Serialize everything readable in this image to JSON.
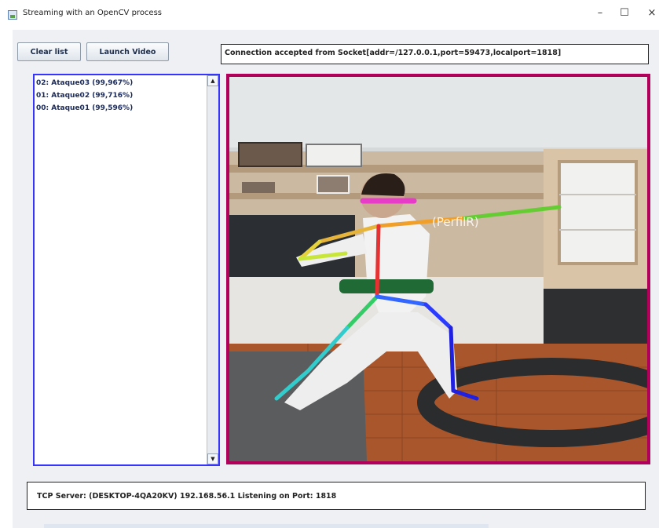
{
  "window": {
    "title": "Streaming with an OpenCV process",
    "controls": [
      "–",
      "☐",
      "×"
    ]
  },
  "toolbar": {
    "clear_label": "Clear list",
    "launch_label": "Launch Video"
  },
  "connection": {
    "text": "Connection accepted from Socket[addr=/127.0.0.1,port=59473,localport=1818]"
  },
  "detections": [
    "02: Ataque03 (99,967%)",
    "01: Ataque02 (99,716%)",
    "00: Ataque01 (99,596%)"
  ],
  "video": {
    "overlay_label": "(PerfilR)",
    "frame_border_color": "#b2005a"
  },
  "list_border_color": "#3535ff",
  "status": {
    "text": "TCP Server: (DESKTOP-4QA20KV) 192.168.56.1 Listening on Port: 1818"
  }
}
